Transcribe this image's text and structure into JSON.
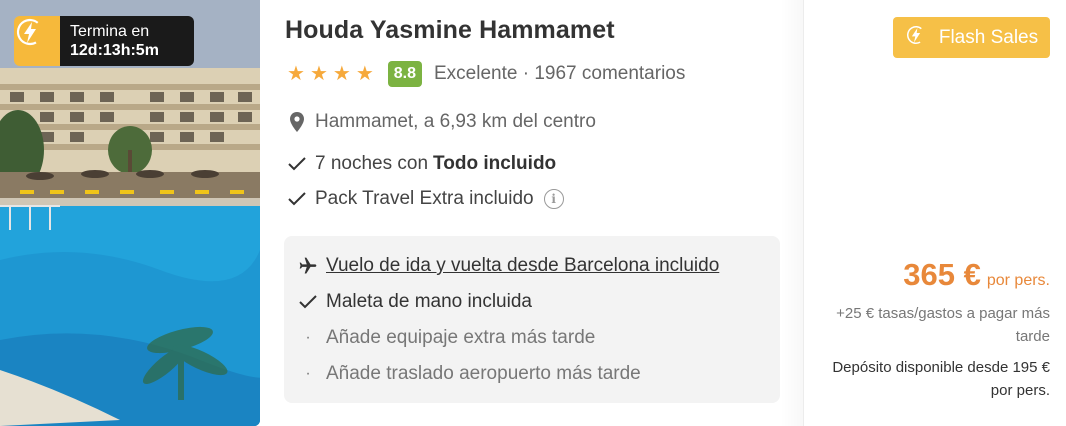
{
  "timer": {
    "label": "Termina en",
    "countdown": "12d:13h:5m"
  },
  "hotel": {
    "name": "Houda Yasmine Hammamet",
    "stars": 4,
    "score": "8.8",
    "review_summary": "Excelente · 1967 comentarios",
    "location": "Hammamet, a 6,93 km del centro"
  },
  "features": {
    "nights_prefix": "7 noches con",
    "nights_bold": "Todo incluido",
    "pack": "Pack Travel Extra incluido",
    "info_glyph": "i"
  },
  "flight": {
    "route": "Vuelo de ida y vuelta desde Barcelona incluido",
    "hand_luggage": "Maleta de mano incluida",
    "extra_luggage": "Añade equipaje extra más tarde",
    "transfer": "Añade traslado aeropuerto más tarde"
  },
  "offer": {
    "badge_label": "Flash Sales",
    "price": "365 €",
    "price_unit": "por pers.",
    "fees": "+25 € tasas/gastos a pagar más tarde",
    "deposit": "Depósito disponible desde 195 € por pers."
  },
  "icons": {
    "bolt": "bolt-icon",
    "star": "star-icon",
    "pin": "location-pin-icon",
    "check": "check-icon",
    "plane": "plane-icon",
    "bullet": "bullet-dot-icon",
    "info": "info-icon"
  },
  "colors": {
    "accent_yellow": "#f6c047",
    "price_orange": "#e8883a",
    "score_green": "#7cb342",
    "star_orange": "#f6a93b"
  }
}
